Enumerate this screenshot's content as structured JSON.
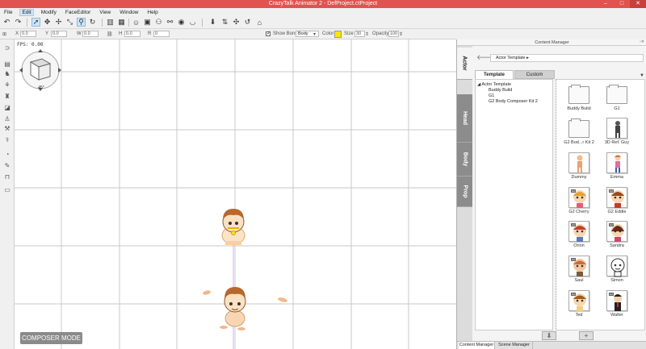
{
  "window": {
    "title": "CrazyTalk Animator 2  -  DefProject.ctProject",
    "controls": [
      "–",
      "□",
      "✕"
    ]
  },
  "menu": [
    "File",
    "Edit",
    "Modify",
    "FaceEditor",
    "View",
    "Window",
    "Help"
  ],
  "menu_active": "Edit",
  "props": {
    "x_label": "X",
    "x_value": "0.0",
    "y_label": "Y",
    "y_value": "0.0",
    "w_label": "W",
    "w_value": "0.0",
    "h_label": "H",
    "h_value": "0.0",
    "r_label": "R",
    "r_value": "0",
    "show_bone_label": "Show Bone",
    "show_bone_checked": "✓",
    "bone_select": "Body",
    "color_label": "Color",
    "color_value": "#ffe500",
    "size_label": "Size",
    "size_value": "30",
    "opacity_label": "Opacity",
    "opacity_value": "100"
  },
  "stage": {
    "fps": "FPS: 0.00",
    "camera_angle": "45°",
    "composer_mode": "COMPOSER MODE"
  },
  "content_manager": {
    "title": "Content Manager",
    "side_tabs": [
      "Actor",
      "Head",
      "Body",
      "Prop"
    ],
    "active_side_tab": "Actor",
    "path": "Actor Template ▸",
    "tabs": [
      "Template",
      "Custom"
    ],
    "active_tab": "Template",
    "tree": [
      "Actor Template",
      "Buddy Build",
      "G1",
      "G2 Body Composer Kit 2"
    ],
    "items": [
      {
        "label": "Buddy Build",
        "kind": "folder"
      },
      {
        "label": "G1",
        "kind": "folder"
      },
      {
        "label": "G2 Bod...r Kit 2",
        "kind": "folder"
      },
      {
        "label": "3D Ref. Guy",
        "kind": "figure"
      },
      {
        "label": "Dummy",
        "kind": "figure"
      },
      {
        "label": "Emma",
        "kind": "figure"
      },
      {
        "label": "G2 Cherry",
        "kind": "figure"
      },
      {
        "label": "G2 Eddie",
        "kind": "figure"
      },
      {
        "label": "Orion",
        "kind": "figure"
      },
      {
        "label": "Sandra",
        "kind": "figure"
      },
      {
        "label": "Saul",
        "kind": "figure"
      },
      {
        "label": "Simon",
        "kind": "figure"
      },
      {
        "label": "Ted",
        "kind": "figure"
      },
      {
        "label": "Walter",
        "kind": "figure"
      }
    ],
    "badge_text": "G2",
    "bottom_buttons": [
      "⬇",
      "+"
    ],
    "bottom_tabs": [
      "Content Manager",
      "Scene Manager"
    ]
  },
  "colors": {
    "titlebar": "#e0534f",
    "stage_bg": "#ffffff",
    "grid": "#c8c8c8",
    "bone_color": "#ffe500"
  }
}
